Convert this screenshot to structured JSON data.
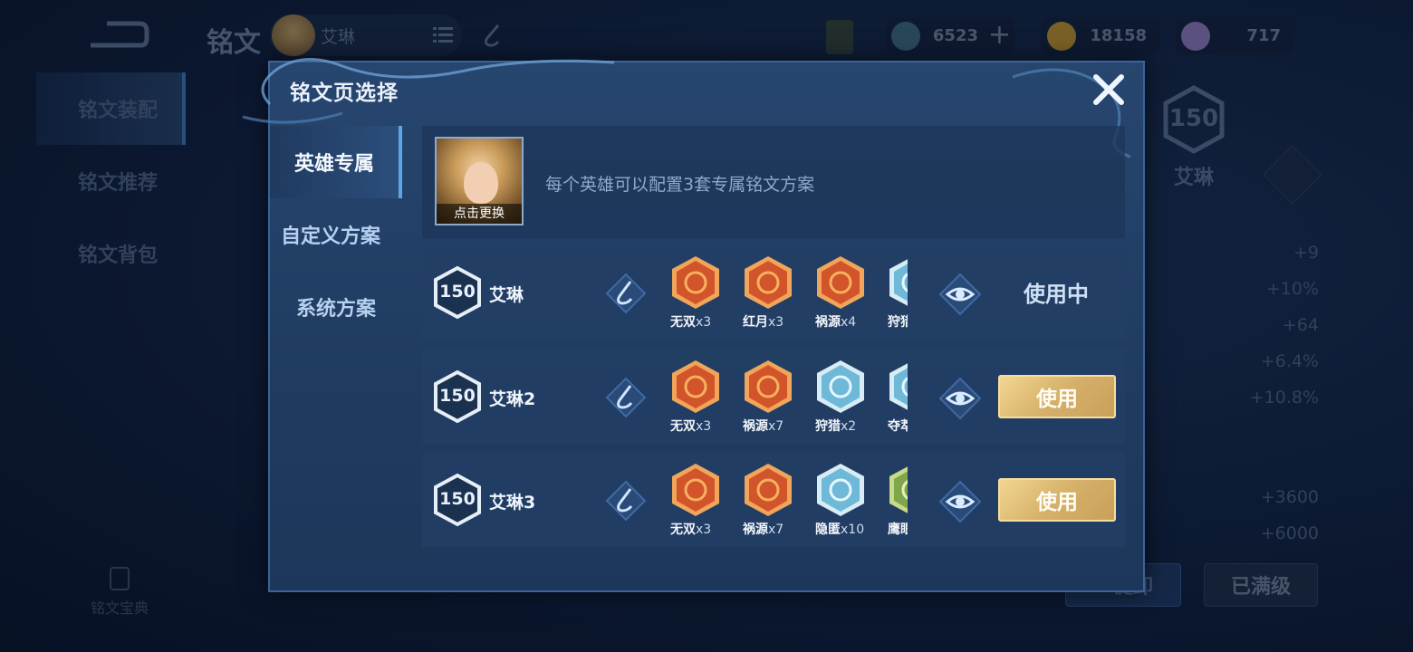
{
  "background": {
    "title": "铭文",
    "hero_name": "艾琳",
    "currencies": [
      {
        "name": "gem-points",
        "value": "6523",
        "color": "#3c6a7e"
      },
      {
        "name": "gold",
        "value": "18158",
        "color": "#b9902f"
      },
      {
        "name": "diamond",
        "value": "717",
        "color": "#8b78b8"
      }
    ],
    "sidenav": [
      {
        "label": "铭文装配",
        "active": true
      },
      {
        "label": "铭文推荐",
        "active": false
      },
      {
        "label": "铭文背包",
        "active": false
      }
    ],
    "guide_label": "铭文宝典",
    "right_level": "150",
    "right_name": "艾琳",
    "stats": [
      "+9",
      "+10%",
      "+64",
      "+6.4%",
      "+10.8%",
      "+3600",
      "+6000"
    ],
    "unload_label": "一键卸",
    "maxed_label": "已满级"
  },
  "modal": {
    "title": "铭文页选择",
    "tabs": [
      {
        "label": "英雄专属",
        "active": true
      },
      {
        "label": "自定义方案",
        "active": false
      },
      {
        "label": "系统方案",
        "active": false
      }
    ],
    "hero_card": {
      "portrait_caption": "点击更换",
      "description": "每个英雄可以配置3套专属铭文方案"
    },
    "plans": [
      {
        "level": "150",
        "name": "艾琳",
        "runes": [
          {
            "label": "无双",
            "count": "x3",
            "kind": "red"
          },
          {
            "label": "红月",
            "count": "x3",
            "kind": "red"
          },
          {
            "label": "祸源",
            "count": "x4",
            "kind": "red"
          },
          {
            "label": "狩猎",
            "count": "",
            "kind": "blue"
          }
        ],
        "status": "使用中",
        "button": ""
      },
      {
        "level": "150",
        "name": "艾琳2",
        "runes": [
          {
            "label": "无双",
            "count": "x3",
            "kind": "red"
          },
          {
            "label": "祸源",
            "count": "x7",
            "kind": "red"
          },
          {
            "label": "狩猎",
            "count": "x2",
            "kind": "blue"
          },
          {
            "label": "夺萃",
            "count": "",
            "kind": "blue"
          }
        ],
        "status": "",
        "button": "使用"
      },
      {
        "level": "150",
        "name": "艾琳3",
        "runes": [
          {
            "label": "无双",
            "count": "x3",
            "kind": "red"
          },
          {
            "label": "祸源",
            "count": "x7",
            "kind": "red"
          },
          {
            "label": "隐匿",
            "count": "x10",
            "kind": "blue"
          },
          {
            "label": "鹰眼",
            "count": "",
            "kind": "green"
          }
        ],
        "status": "",
        "button": "使用"
      }
    ]
  },
  "colors": {
    "accent_blue": "#5aa7e8",
    "gold_button": "#d6b16a",
    "rune_red": "#d1542a",
    "rune_blue": "#6fb9d8",
    "rune_green": "#7fa64a"
  }
}
